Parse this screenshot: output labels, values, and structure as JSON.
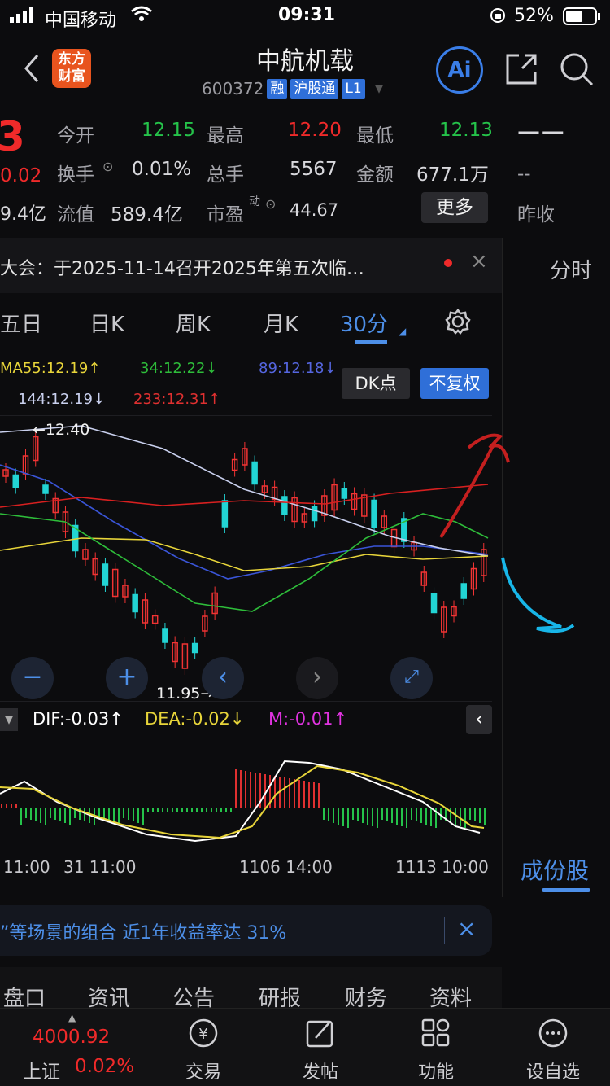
{
  "status_bar": {
    "carrier": "中国移动",
    "time": "09:31",
    "battery": "52%"
  },
  "header": {
    "brand_line1": "东方",
    "brand_line2": "财富",
    "title": "中航机载",
    "code": "600372",
    "tags": [
      "融",
      "沪股通",
      "L1"
    ],
    "ai_label": "Ai"
  },
  "quote": {
    "price_fragment": "3",
    "change_fragment": "0.02",
    "mktcap_fragment": "9.4亿",
    "open_label": "今开",
    "open": "12.15",
    "high_label": "最高",
    "high": "12.20",
    "low_label": "最低",
    "low": "12.13",
    "dash": "— —",
    "turnover_label": "换手",
    "turnover": "0.01%",
    "volume_label": "总手",
    "volume": "5567",
    "amount_label": "金额",
    "amount": "677.1万",
    "prev_dash": "--",
    "float_label": "流值",
    "float_value": "589.4亿",
    "pe_label": "市盈",
    "pe_sup": "动",
    "pe": "44.67",
    "more_label": "更多",
    "prev_close_label": "昨收"
  },
  "notice": {
    "text": "大会：于2025-11-14召开2025年第五次临…"
  },
  "side_panel": {
    "time_share": "分时",
    "components": "成份股"
  },
  "chart_tabs": [
    "五日",
    "日K",
    "周K",
    "月K",
    "30分"
  ],
  "ma": {
    "ma55": "MA55:12.19↑",
    "ma34": "34:12.22↓",
    "ma89": "89:12.18↓",
    "ma144": "144:12.19↓",
    "ma233": "233:12.31↑",
    "dk_label": "DK点",
    "fq_label": "不复权"
  },
  "chart_data": {
    "type": "candlestick",
    "high_label": "12.40",
    "low_label": "11.95",
    "y_range": [
      11.95,
      12.4
    ],
    "colors": {
      "up": "#f23333",
      "down": "#22d4d4",
      "ma55": "#e8d53a",
      "ma34": "#2ebd3a",
      "ma89": "#3a55d8",
      "ma144": "#c9d0ee",
      "ma233": "#d82020"
    }
  },
  "macd": {
    "dif": "DIF:-0.03↑",
    "dea": "DEA:-0.02↓",
    "m": "M:-0.01↑",
    "colors": {
      "dif": "#ffffff",
      "dea": "#e8d53a",
      "m": "#e033e0",
      "pos": "#e03030",
      "neg": "#25c34a"
    }
  },
  "x_axis": [
    "11:00",
    "31 11:00",
    "1106 14:00",
    "1113 10:00"
  ],
  "ad": {
    "text": "”等场景的组合 近1年收益率达 31%"
  },
  "bottom_tabs": [
    "盘口",
    "资讯",
    "公告",
    "研报",
    "财务",
    "资料"
  ],
  "tabbar": {
    "index_value": "4000.92",
    "index_name": "上证",
    "index_change": "0.02%",
    "items": [
      "交易",
      "发帖",
      "功能",
      "设自选"
    ]
  }
}
